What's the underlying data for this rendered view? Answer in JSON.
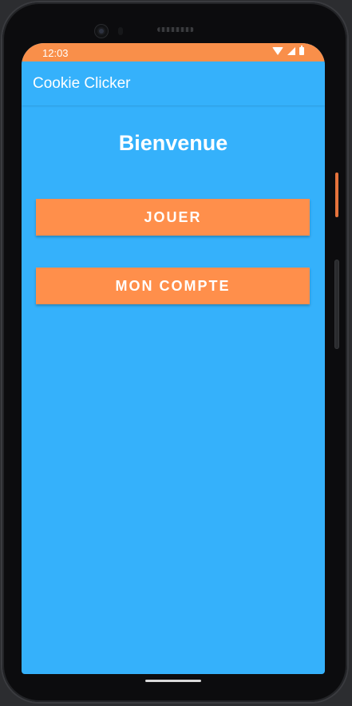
{
  "status_bar": {
    "time": "12:03",
    "background_color": "#f98f4a",
    "icons": [
      "wifi-icon",
      "signal-icon",
      "battery-icon"
    ]
  },
  "app_bar": {
    "title": "Cookie Clicker",
    "background_color": "#35b1fb"
  },
  "main": {
    "title": "Bienvenue",
    "buttons": [
      {
        "label": "JOUER",
        "color": "#ff8f4b"
      },
      {
        "label": "MON COMPTE",
        "color": "#ff8f4b"
      }
    ]
  },
  "colors": {
    "accent": "#ff8f4b",
    "background": "#35b1fb",
    "text": "#ffffff"
  }
}
